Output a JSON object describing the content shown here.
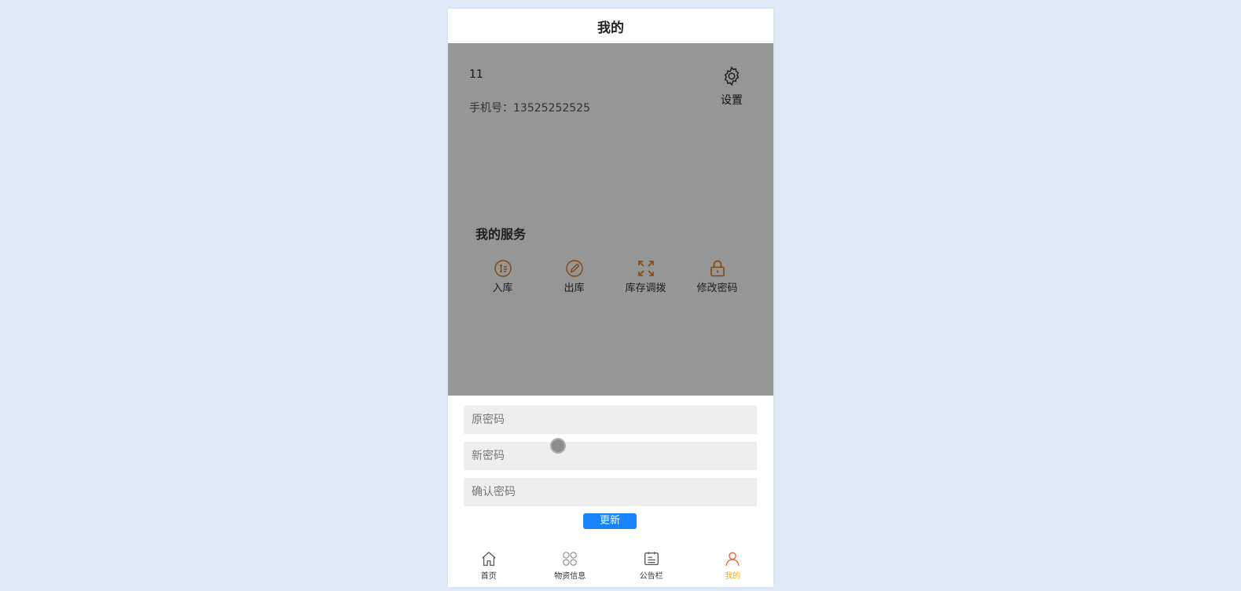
{
  "navbar": {
    "title": "我的"
  },
  "user": {
    "name": "11",
    "phone_label": "手机号：",
    "phone": "13525252525"
  },
  "settings": {
    "label": "设置",
    "icon": "gear-icon"
  },
  "services": {
    "title": "我的服务",
    "items": [
      {
        "label": "入库",
        "icon": "document-list-icon"
      },
      {
        "label": "出库",
        "icon": "pencil-circle-icon"
      },
      {
        "label": "库存调拨",
        "icon": "expand-arrows-icon"
      },
      {
        "label": "修改密码",
        "icon": "lock-icon"
      }
    ]
  },
  "password_form": {
    "old_placeholder": "原密码",
    "new_placeholder": "新密码",
    "confirm_placeholder": "确认密码",
    "submit_label": "更新"
  },
  "tabbar": {
    "items": [
      {
        "label": "首页",
        "icon": "home-icon"
      },
      {
        "label": "物资信息",
        "icon": "grid-icon"
      },
      {
        "label": "公告栏",
        "icon": "notice-board-icon"
      },
      {
        "label": "我的",
        "icon": "user-icon",
        "active": true
      }
    ]
  },
  "colors": {
    "accent_orange": "#e07a1f",
    "active_tab": "#f5b400",
    "update_button": "#1a83ff",
    "mask": "#666666"
  }
}
